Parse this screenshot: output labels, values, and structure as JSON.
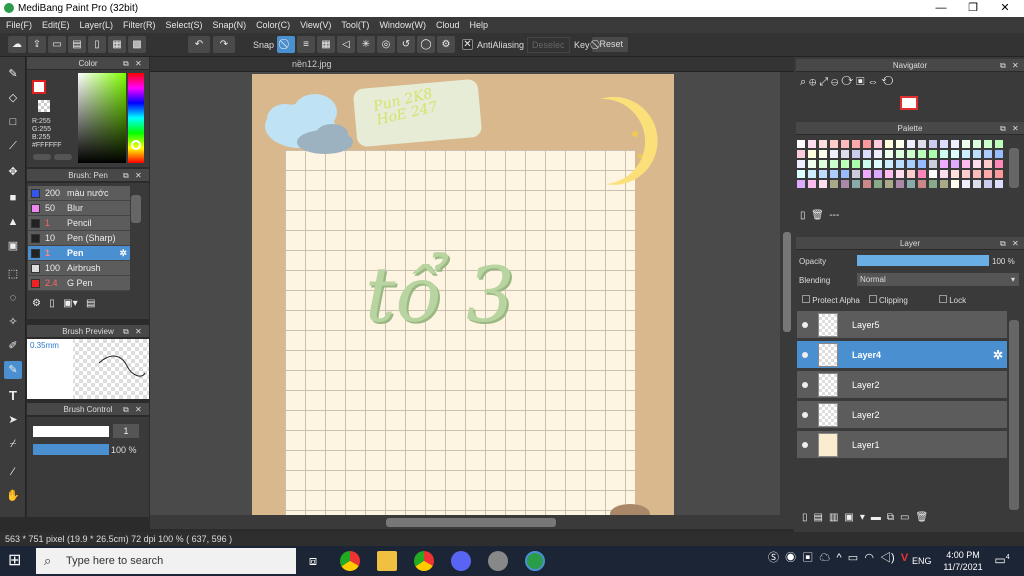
{
  "window": {
    "title": "MediBang Paint Pro (32bit)",
    "minimize": "—",
    "maximize": "❐",
    "close": "✕"
  },
  "menu": [
    "File(F)",
    "Edit(E)",
    "Layer(L)",
    "Filter(R)",
    "Select(S)",
    "Snap(N)",
    "Color(C)",
    "View(V)",
    "Tool(T)",
    "Window(W)",
    "Cloud",
    "Help"
  ],
  "toolbar": {
    "snap_label": "Snap",
    "antialias_label": "AntiAliasing",
    "deselect_label": "Deselec",
    "key_label": "Key",
    "reset_label": "Reset"
  },
  "color_panel": {
    "title": "Color",
    "r": "R:255",
    "g": "G:255",
    "b": "B:255",
    "hex": "#FFFFFF"
  },
  "brush_panel": {
    "title": "Brush: Pen",
    "items": [
      {
        "size": "200",
        "name": "màu nước",
        "color": "#3355ee"
      },
      {
        "size": "50",
        "name": "Blur",
        "color": "#ee88ee"
      },
      {
        "size": "1",
        "name": "Pencil",
        "color": "#222222"
      },
      {
        "size": "10",
        "name": "Pen (Sharp)",
        "color": "#222222"
      },
      {
        "size": "1",
        "name": "Pen",
        "color": "#222222"
      },
      {
        "size": "100",
        "name": "Airbrush",
        "color": "#dddddd"
      },
      {
        "size": "2.4",
        "name": "G Pen",
        "color": "#ee2222"
      }
    ]
  },
  "brush_preview": {
    "title": "Brush Preview",
    "size": "0.35mm"
  },
  "brush_control": {
    "title": "Brush Control",
    "size_value": "1",
    "opacity_value": "100 %",
    "opacity_fraction": 1.0
  },
  "canvas_tab": {
    "filename": "nền12.jpg"
  },
  "artwork": {
    "sticker_text": "Pun 2K8\nHoE 247",
    "main_text": "tổ 3"
  },
  "navigator": {
    "title": "Navigator"
  },
  "palette": {
    "title": "Palette",
    "footer": "---"
  },
  "layer_panel": {
    "title": "Layer",
    "opacity_label": "Opacity",
    "opacity_value": "100 %",
    "opacity_fraction": 1.0,
    "blending_label": "Blending",
    "blending_value": "Normal",
    "protect_alpha": "Protect Alpha",
    "clipping": "Clipping",
    "lock": "Lock",
    "layers": [
      {
        "name": "Layer5",
        "selected": false
      },
      {
        "name": "Layer4",
        "selected": true
      },
      {
        "name": "Layer2",
        "selected": false
      },
      {
        "name": "Layer2",
        "selected": false
      },
      {
        "name": "Layer1",
        "selected": false
      }
    ]
  },
  "status_bar": {
    "text": "563 * 751 pixel  (19.9 * 26.5cm)  72 dpi  100 %  ( 637, 596 )"
  },
  "taskbar": {
    "search_placeholder": "Type here to search",
    "language": "ENG",
    "time": "4:00 PM",
    "date": "11/7/2021",
    "notifications": "4"
  }
}
